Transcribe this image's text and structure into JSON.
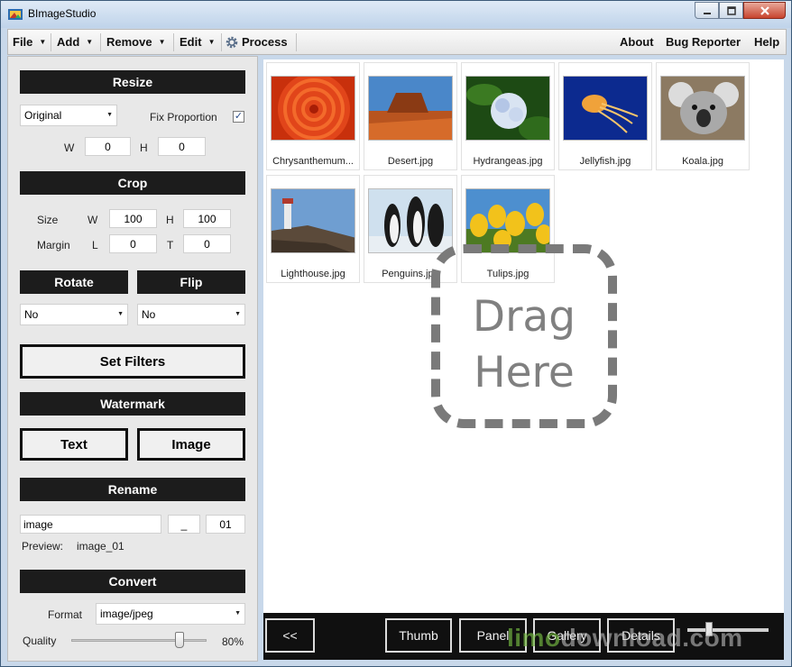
{
  "window": {
    "title": "BImageStudio"
  },
  "menu": {
    "file": "File",
    "add": "Add",
    "remove": "Remove",
    "edit": "Edit",
    "process": "Process",
    "about": "About",
    "bug_reporter": "Bug Reporter",
    "help": "Help"
  },
  "resize": {
    "header": "Resize",
    "size_option": "Original",
    "fix_proportion_label": "Fix Proportion",
    "fix_proportion_checked": true,
    "w_label": "W",
    "h_label": "H",
    "w_value": "0",
    "h_value": "0"
  },
  "crop": {
    "header": "Crop",
    "size_label": "Size",
    "margin_label": "Margin",
    "w_label": "W",
    "h_label": "H",
    "l_label": "L",
    "t_label": "T",
    "w_value": "100",
    "h_value": "100",
    "l_value": "0",
    "t_value": "0"
  },
  "rotate": {
    "header": "Rotate",
    "value": "No"
  },
  "flip": {
    "header": "Flip",
    "value": "No"
  },
  "filters": {
    "button": "Set Filters"
  },
  "watermark": {
    "header": "Watermark",
    "text_button": "Text",
    "image_button": "Image"
  },
  "rename": {
    "header": "Rename",
    "name_value": "image",
    "separator_value": "_",
    "number_value": "01",
    "preview_label": "Preview:",
    "preview_value": "image_01"
  },
  "convert": {
    "header": "Convert",
    "format_label": "Format",
    "format_value": "image/jpeg",
    "quality_label": "Quality",
    "quality_value": "80%",
    "quality_fraction": 0.8
  },
  "thumbnails": [
    {
      "name": "Chrysanthemum...",
      "image": "chrysanthemum"
    },
    {
      "name": "Desert.jpg",
      "image": "desert"
    },
    {
      "name": "Hydrangeas.jpg",
      "image": "hydrangeas"
    },
    {
      "name": "Jellyfish.jpg",
      "image": "jellyfish"
    },
    {
      "name": "Koala.jpg",
      "image": "koala"
    },
    {
      "name": "Lighthouse.jpg",
      "image": "lighthouse"
    },
    {
      "name": "Penguins.jpg",
      "image": "penguins"
    },
    {
      "name": "Tulips.jpg",
      "image": "tulips"
    }
  ],
  "drop_zone": {
    "line1": "Drag",
    "line2": "Here"
  },
  "bottom": {
    "collapse_button": "<<",
    "thumb_button": "Thumb",
    "panel_button": "Panel",
    "gallery_button": "Gallery",
    "details_button": "Details"
  },
  "watermark_overlay": {
    "part1": "limo",
    "part2": "download.com"
  },
  "colors": {
    "header_bg": "#1c1c1c",
    "bottom_bar_bg": "#101010",
    "check_color": "#2a4c8a"
  }
}
